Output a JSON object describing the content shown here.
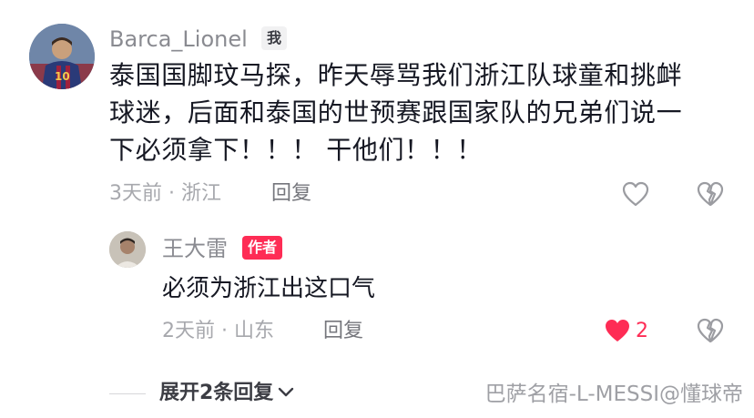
{
  "comment": {
    "username": "Barca_Lionel",
    "tag": "我",
    "lines": [
      "泰国国脚玟马探，昨天辱骂我们浙江队球童和挑衅",
      "球迷，后面和泰国的世预赛跟国家队的兄弟们说一",
      "下必须拿下！！！ 干他们！！！"
    ],
    "meta": "3天前 · 浙江",
    "reply_label": "回复",
    "like_icon": "heart-outline-icon",
    "dislike_icon": "broken-heart-icon"
  },
  "reply": {
    "username": "王大雷",
    "tag": "作者",
    "text": "必须为浙江出这口气",
    "meta": "2天前 · 山东",
    "reply_label": "回复",
    "like_count": "2",
    "like_icon": "heart-filled-icon",
    "dislike_icon": "broken-heart-icon"
  },
  "expand_label": "展开2条回复",
  "watermark": "巴萨名宿-L-MESSI@懂球帝",
  "colors": {
    "accent": "#fe2c55",
    "muted": "#a7a8ad",
    "text": "#161823"
  }
}
